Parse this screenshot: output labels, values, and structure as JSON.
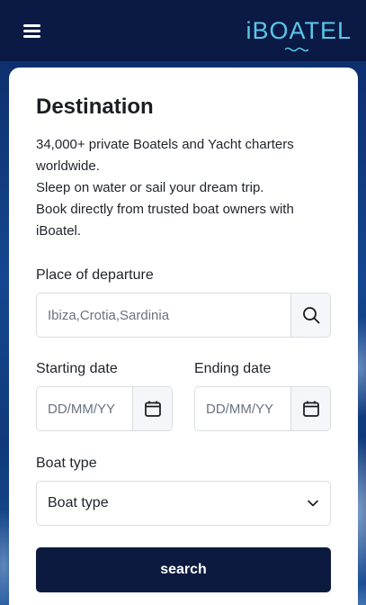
{
  "header": {
    "logo_text": "iBOATEL",
    "menu_icon": "hamburger-menu-icon"
  },
  "card": {
    "title": "Destination",
    "description_lines": [
      "34,000+ private Boatels and Yacht charters",
      "worldwide.",
      "Sleep on water or sail your dream trip.",
      "Book directly from trusted boat owners with",
      "iBoatel."
    ],
    "departure": {
      "label": "Place of departure",
      "placeholder": "Ibiza,Crotia,Sardinia",
      "icon": "search-icon"
    },
    "start_date": {
      "label": "Starting date",
      "placeholder": "DD/MM/YY",
      "icon": "calendar-icon"
    },
    "end_date": {
      "label": "Ending date",
      "placeholder": "DD/MM/YY",
      "icon": "calendar-icon"
    },
    "boat_type": {
      "label": "Boat type",
      "selected": "Boat type",
      "icon": "chevron-down-icon"
    },
    "search_button": "search"
  },
  "colors": {
    "header_bg": "#0a1a44",
    "logo": "#5cc6ea",
    "button_bg": "#0c1a3f"
  }
}
